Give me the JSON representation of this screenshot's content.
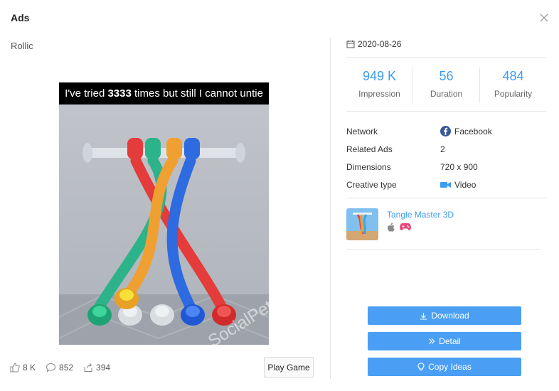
{
  "modal": {
    "title": "Ads",
    "close_icon": "close-icon"
  },
  "advertiser": "Rollic",
  "creative": {
    "caption_prefix": "I've tried ",
    "caption_number": "3333",
    "caption_suffix": " times but still I cannot untie",
    "watermark": "SocialPeta"
  },
  "engagement": {
    "likes": "8 K",
    "comments": "852",
    "shares": "394"
  },
  "play_button": "Play Game",
  "date": "2020-08-26",
  "metrics": [
    {
      "value": "949 K",
      "label": "Impression"
    },
    {
      "value": "56",
      "label": "Duration"
    },
    {
      "value": "484",
      "label": "Popularity"
    }
  ],
  "info": {
    "network_label": "Network",
    "network_value": "Facebook",
    "related_label": "Related Ads",
    "related_value": "2",
    "dimensions_label": "Dimensions",
    "dimensions_value": "720 x 900",
    "type_label": "Creative type",
    "type_value": "Video"
  },
  "app": {
    "name": "Tangle Master 3D",
    "platform_icons": [
      "apple-icon",
      "gamepad-icon"
    ]
  },
  "actions": {
    "download": "Download",
    "detail": "Detail",
    "copy_ideas": "Copy Ideas"
  },
  "colors": {
    "accent": "#3d9cf0",
    "button": "#4a9ff5",
    "facebook": "#3b5998",
    "gamepad": "#e8457a"
  }
}
